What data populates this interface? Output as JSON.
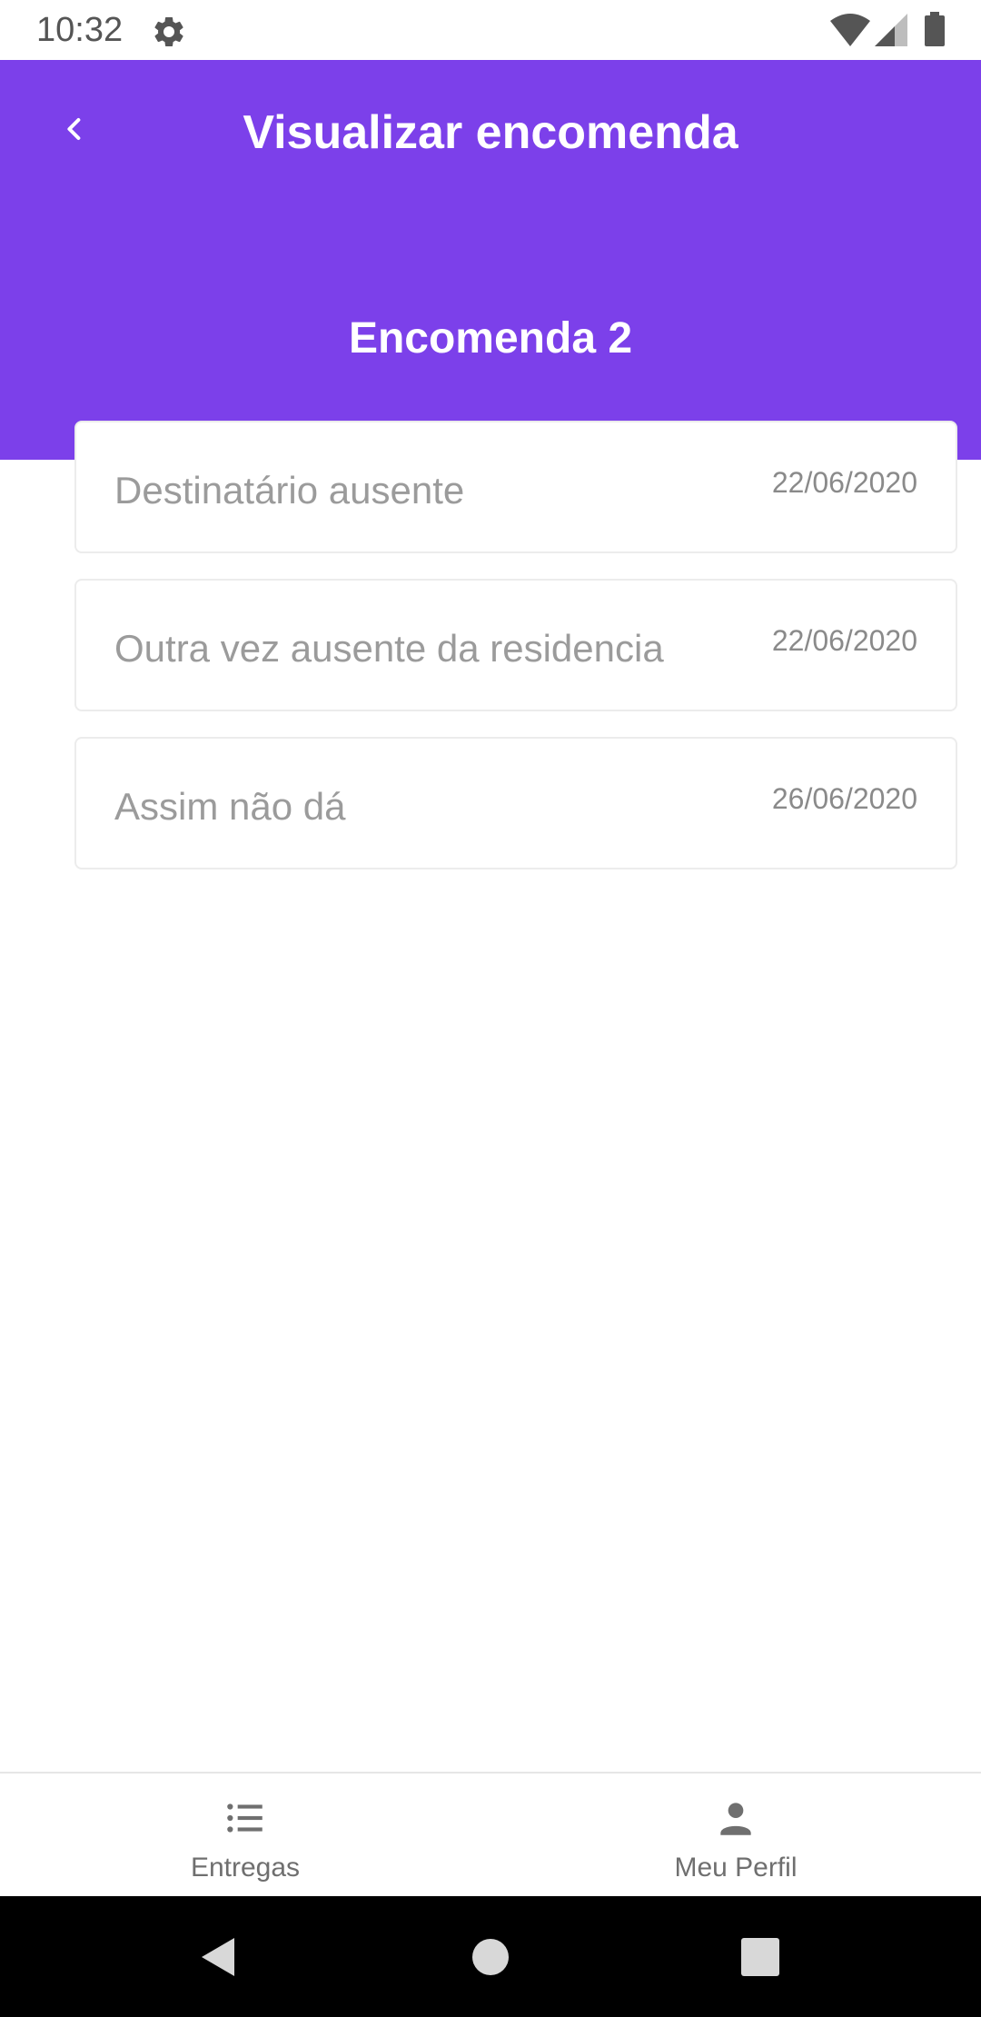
{
  "status_bar": {
    "time": "10:32"
  },
  "header": {
    "title": "Visualizar encomenda",
    "subtitle": "Encomenda 2",
    "background_color": "#7c40ea"
  },
  "occurrences": [
    {
      "text": "Destinatário ausente",
      "date": "22/06/2020"
    },
    {
      "text": "Outra vez ausente da residencia",
      "date": "22/06/2020"
    },
    {
      "text": "Assim não dá",
      "date": "26/06/2020"
    }
  ],
  "bottom_nav": {
    "items": [
      {
        "label": "Entregas",
        "icon": "list-icon"
      },
      {
        "label": "Meu Perfil",
        "icon": "person-icon"
      }
    ]
  },
  "system_nav": {
    "icons": [
      "back-triangle-icon",
      "home-circle-icon",
      "recents-square-icon"
    ]
  }
}
